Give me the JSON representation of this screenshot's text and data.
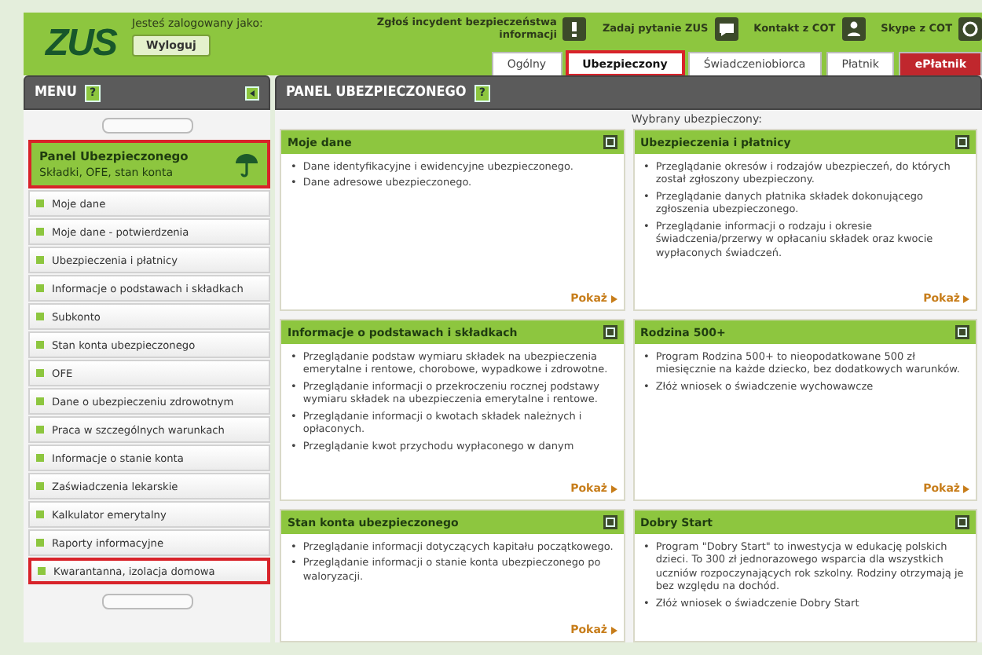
{
  "header": {
    "logo": "ZUS",
    "login_label": "Jesteś zalogowany jako:",
    "logout": "Wyloguj",
    "links": [
      {
        "label": "Zgłoś incydent bezpieczeństwa informacji",
        "kind": "alert"
      },
      {
        "label": "Zadaj pytanie ZUS",
        "kind": "question"
      },
      {
        "label": "Kontakt z COT",
        "kind": "contact"
      },
      {
        "label": "Skype z COT",
        "kind": "skype"
      }
    ]
  },
  "tabs": [
    {
      "label": "Ogólny",
      "selected": false,
      "highlighted": false,
      "kind": "normal"
    },
    {
      "label": "Ubezpieczony",
      "selected": true,
      "highlighted": true,
      "kind": "normal"
    },
    {
      "label": "Świadczeniobiorca",
      "selected": false,
      "highlighted": false,
      "kind": "normal"
    },
    {
      "label": "Płatnik",
      "selected": false,
      "highlighted": false,
      "kind": "normal"
    },
    {
      "label": "ePłatnik",
      "selected": false,
      "highlighted": false,
      "kind": "special"
    }
  ],
  "menu": {
    "title": "MENU",
    "help": "?",
    "panel": {
      "title": "Panel Ubezpieczonego",
      "subtitle": "Składki, OFE, stan konta",
      "highlighted": true
    },
    "items": [
      {
        "label": "Moje dane",
        "highlighted": false
      },
      {
        "label": "Moje dane - potwierdzenia",
        "highlighted": false
      },
      {
        "label": "Ubezpieczenia i płatnicy",
        "highlighted": false
      },
      {
        "label": "Informacje o podstawach i składkach",
        "highlighted": false
      },
      {
        "label": "Subkonto",
        "highlighted": false
      },
      {
        "label": "Stan konta ubezpieczonego",
        "highlighted": false
      },
      {
        "label": "OFE",
        "highlighted": false
      },
      {
        "label": "Dane o ubezpieczeniu zdrowotnym",
        "highlighted": false
      },
      {
        "label": "Praca w szczególnych warunkach",
        "highlighted": false
      },
      {
        "label": "Informacje o stanie konta",
        "highlighted": false
      },
      {
        "label": "Zaświadczenia lekarskie",
        "highlighted": false
      },
      {
        "label": "Kalkulator emerytalny",
        "highlighted": false
      },
      {
        "label": "Raporty informacyjne",
        "highlighted": false
      },
      {
        "label": "Kwarantanna, izolacja domowa",
        "highlighted": true
      }
    ]
  },
  "main": {
    "title": "PANEL UBEZPIECZONEGO",
    "help": "?",
    "bullet": "•",
    "selected_label": "Wybrany ubezpieczony:",
    "cards": [
      {
        "title": "Moje dane",
        "items": [
          "Dane identyfikacyjne i ewidencyjne ubezpieczonego.",
          "Dane adresowe ubezpieczonego."
        ],
        "show_link": "Pokaż"
      },
      {
        "title": "Ubezpieczenia i płatnicy",
        "items": [
          "Przeglądanie okresów i rodzajów ubezpieczeń, do których został zgłoszony ubezpieczony.",
          "Przeglądanie danych płatnika składek dokonującego zgłoszenia ubezpieczonego.",
          "Przeglądanie informacji o rodzaju i okresie świadczenia/przerwy w opłacaniu składek oraz kwocie wypłaconych świadczeń."
        ],
        "show_link": "Pokaż"
      },
      {
        "title": "Informacje o podstawach i składkach",
        "items": [
          "Przeglądanie podstaw wymiaru składek na ubezpieczenia emerytalne i rentowe, chorobowe, wypadkowe i zdrowotne.",
          "Przeglądanie informacji o przekroczeniu rocznej podstawy wymiaru składek na ubezpieczenia emerytalne i rentowe.",
          "Przeglądanie informacji o kwotach składek należnych i opłaconych.",
          "Przeglądanie kwot przychodu wypłaconego w danym"
        ],
        "show_link": "Pokaż"
      },
      {
        "title": "Rodzina 500+",
        "items": [
          "Program Rodzina 500+ to nieopodatkowane 500 zł miesięcznie na każde dziecko, bez dodatkowych warunków.",
          "Złóż wniosek o świadczenie wychowawcze"
        ],
        "show_link": "Pokaż"
      },
      {
        "title": "Stan konta ubezpieczonego",
        "items": [
          "Przeglądanie informacji dotyczących kapitału początkowego.",
          "Przeglądanie informacji o stanie konta ubezpieczonego po waloryzacji."
        ],
        "show_link": "Pokaż"
      },
      {
        "title": "Dobry Start",
        "items": [
          "Program \"Dobry Start\" to inwestycja w edukację polskich dzieci. To 300 zł jednorazowego wsparcia dla wszystkich uczniów rozpoczynających rok szkolny. Rodziny otrzymają je bez względu na dochód.",
          "Złóż wniosek o świadczenie Dobry Start"
        ]
      }
    ]
  }
}
